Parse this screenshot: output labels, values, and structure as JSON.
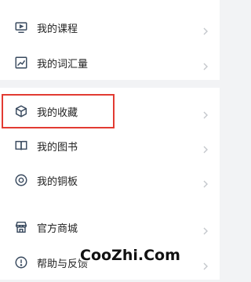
{
  "menu": {
    "groups": [
      {
        "items": [
          {
            "label": "我的课程",
            "icon": "monitor-icon"
          },
          {
            "label": "我的词汇量",
            "icon": "chart-icon"
          }
        ]
      },
      {
        "items": [
          {
            "label": "我的收藏",
            "icon": "cube-icon"
          },
          {
            "label": "我的图书",
            "icon": "book-icon"
          },
          {
            "label": "我的铜板",
            "icon": "coin-icon"
          }
        ]
      },
      {
        "items": [
          {
            "label": "官方商城",
            "icon": "store-icon"
          },
          {
            "label": "帮助与反馈",
            "icon": "help-icon"
          }
        ]
      }
    ]
  },
  "watermark": "CooZhi.Com",
  "colors": {
    "background": "#f2f3f5",
    "card": "#ffffff",
    "icon": "#38495e",
    "highlight": "#e23b32",
    "chevron": "#c4c7cc"
  }
}
